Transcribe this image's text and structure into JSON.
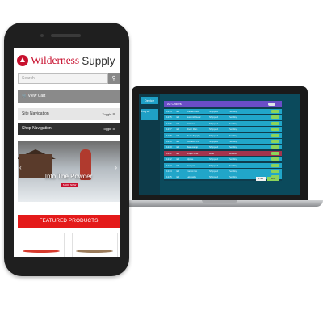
{
  "phone_site": {
    "logo_word1": "Wilderness",
    "logo_word2": "Supply",
    "search_placeholder": "Search",
    "view_cart": "View Cart",
    "site_navigation": "Site Navigation",
    "shop_navigation": "Shop Navigation",
    "toggle_label": "Toggle",
    "hero_title": "Into The Powder",
    "hero_cta": "SHOP NOW",
    "featured_products": "FEATURED PRODUCTS",
    "product_colors": [
      "#d6392c",
      "#9a7b5a"
    ]
  },
  "laptop_dashboard": {
    "sidebar_heading": "Device",
    "sidebar_item": "Log all",
    "panel_title": "All Orders",
    "rows": [
      {
        "c1": "1234",
        "c2": "4/2",
        "c3": "Wilderness",
        "c4": "Shipped",
        "c5": "Pending"
      },
      {
        "c1": "1235",
        "c2": "4/2",
        "c3": "Summit Gear",
        "c4": "Shipped",
        "c5": "Pending"
      },
      {
        "c1": "1236",
        "c2": "4/2",
        "c3": "Trail Co",
        "c4": "Shipped",
        "c5": "Pending"
      },
      {
        "c1": "1237",
        "c2": "4/2",
        "c3": "River Run",
        "c4": "Shipped",
        "c5": "Pending"
      },
      {
        "c1": "1238",
        "c2": "4/2",
        "c3": "Peak Supply",
        "c4": "Shipped",
        "c5": "Pending"
      },
      {
        "c1": "1239",
        "c2": "4/2",
        "c3": "Outdoor Co",
        "c4": "Shipped",
        "c5": "Pending"
      },
      {
        "c1": "1240",
        "c2": "4/2",
        "c3": "Basecamp",
        "c4": "Shipped",
        "c5": "Pending"
      },
      {
        "c1": "1241",
        "c2": "4/2",
        "c3": "Ridge Line",
        "c4": "Hold",
        "c5": "Review"
      },
      {
        "c1": "1242",
        "c2": "4/2",
        "c3": "Alpine",
        "c4": "Shipped",
        "c5": "Pending"
      },
      {
        "c1": "1243",
        "c2": "4/2",
        "c3": "Canyon",
        "c4": "Shipped",
        "c5": "Pending"
      },
      {
        "c1": "1244",
        "c2": "4/2",
        "c3": "Forest Co",
        "c4": "Shipped",
        "c5": "Pending"
      },
      {
        "c1": "1245",
        "c2": "4/2",
        "c3": "Lakeside",
        "c4": "Shipped",
        "c5": "Pending"
      }
    ],
    "alert_row_index": 7,
    "footer_prev": "Prev",
    "footer_next": "Next"
  }
}
